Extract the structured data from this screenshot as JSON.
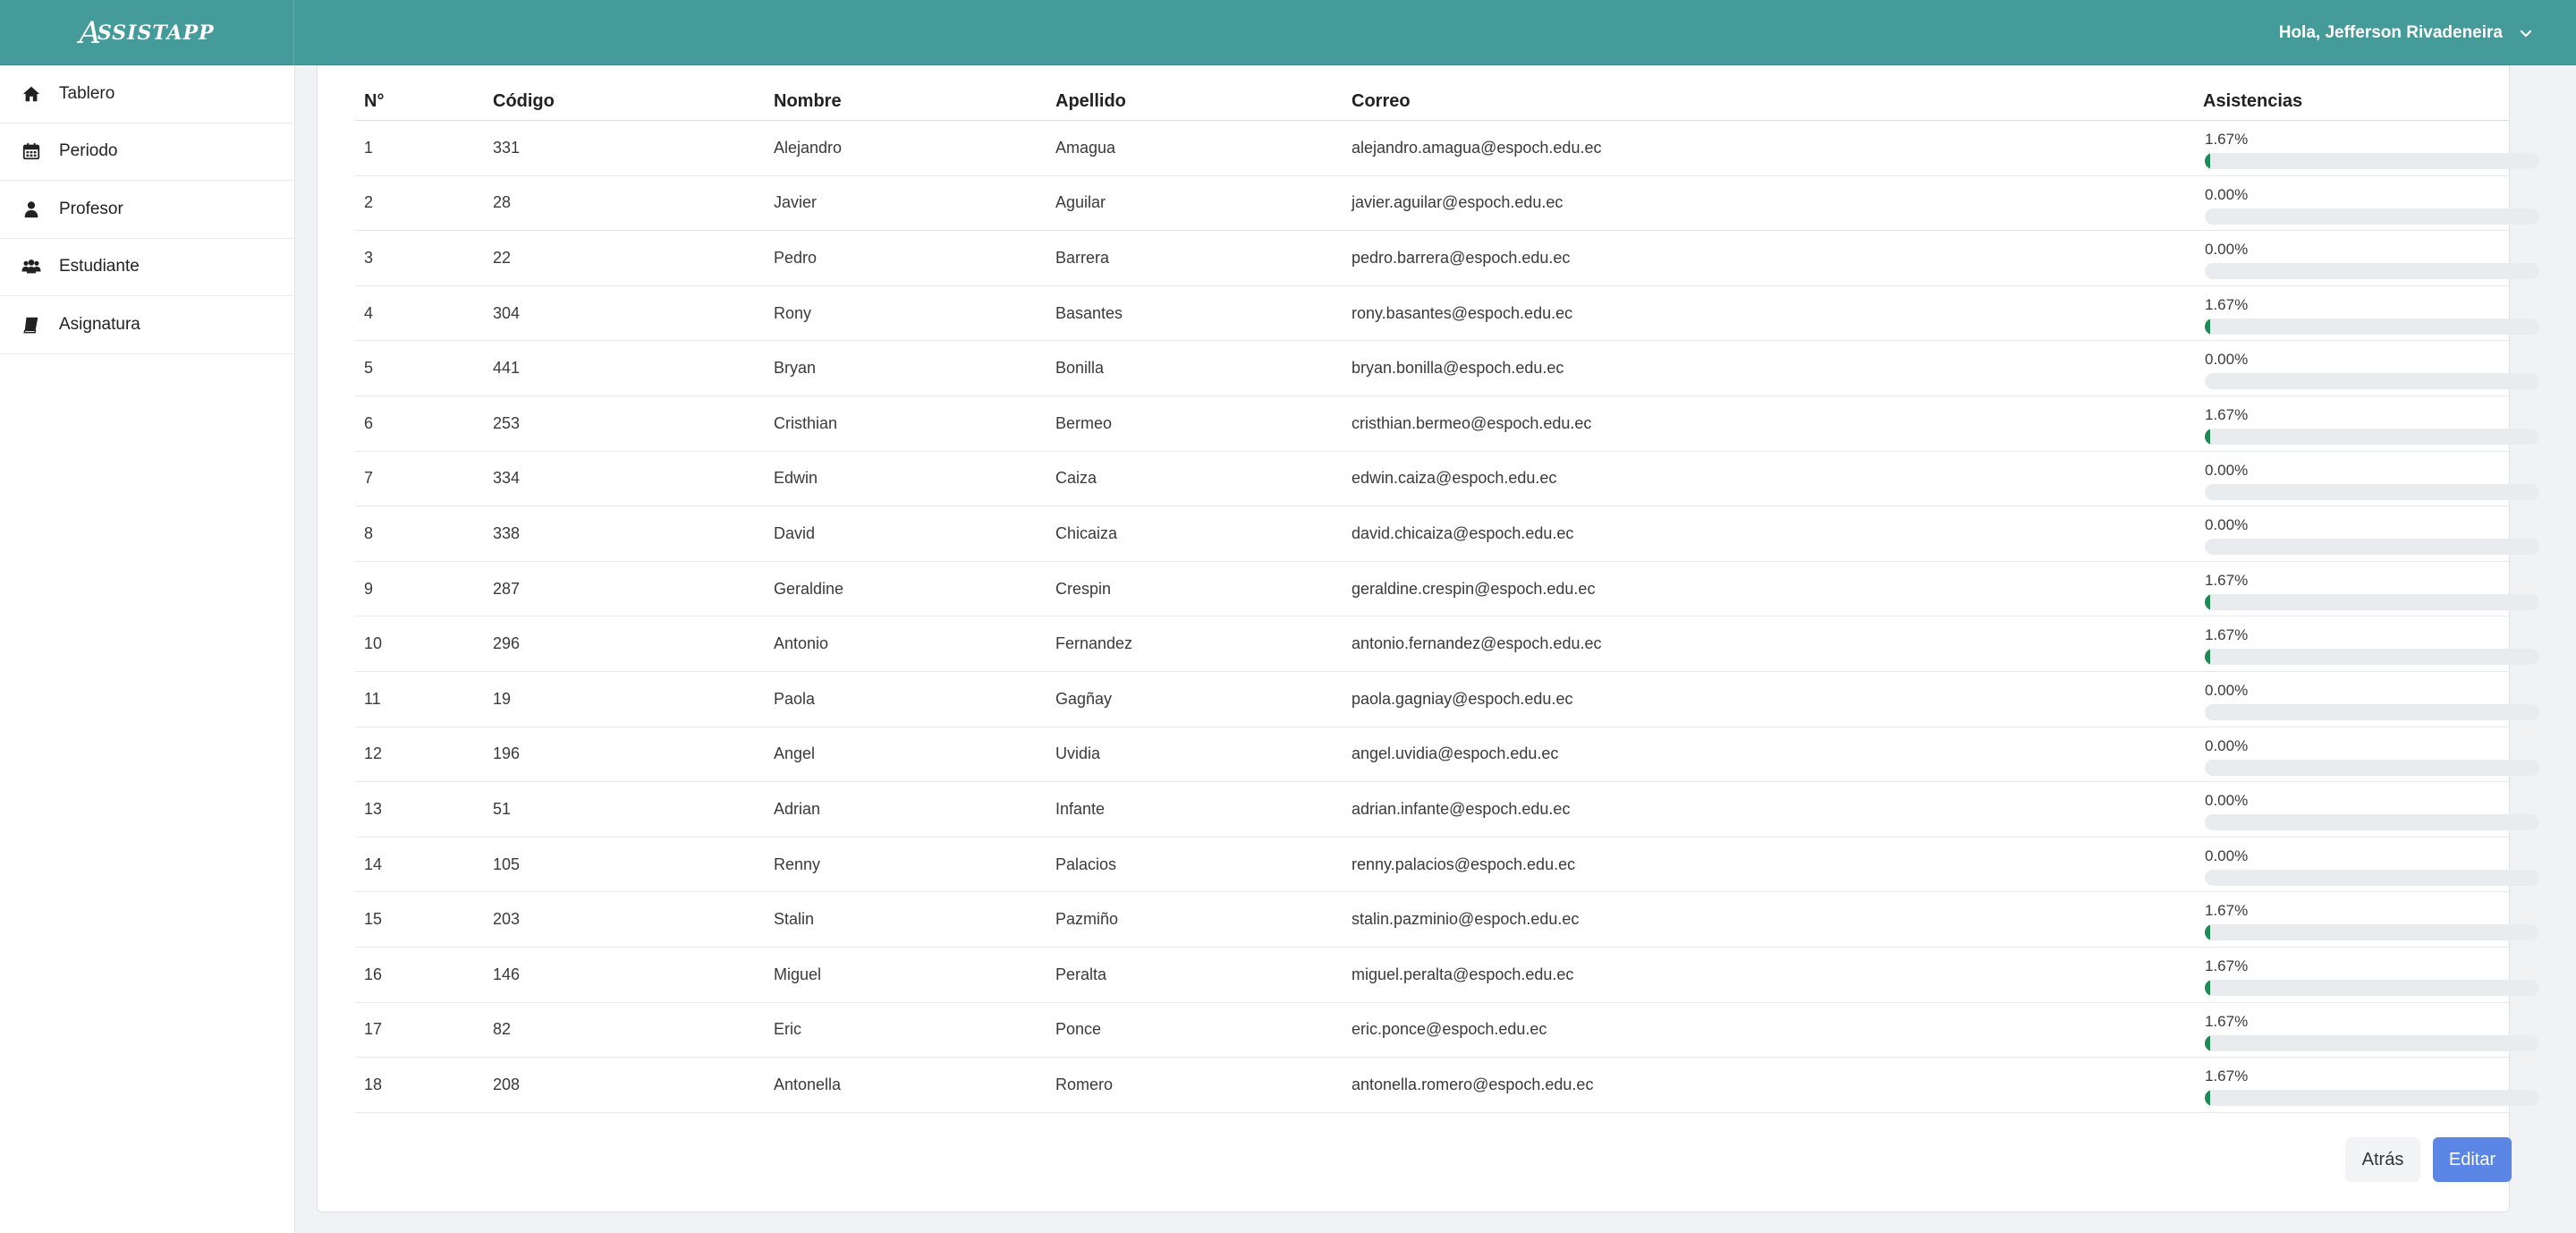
{
  "app": {
    "brand": "SSISTAPP",
    "brand_initial": "A",
    "greeting": "Hola, Jefferson Rivadeneira"
  },
  "colors": {
    "header": "#459a9a",
    "progress_fill": "#1f8a55",
    "progress_track": "#e9ecef",
    "primary_button": "#5b86e5"
  },
  "sidebar": {
    "items": [
      {
        "label": "Tablero",
        "icon": "home-icon"
      },
      {
        "label": "Periodo",
        "icon": "calendar-icon"
      },
      {
        "label": "Profesor",
        "icon": "user-icon"
      },
      {
        "label": "Estudiante",
        "icon": "users-icon"
      },
      {
        "label": "Asignatura",
        "icon": "book-icon"
      }
    ]
  },
  "table": {
    "headers": {
      "no": "N°",
      "codigo": "Código",
      "nombre": "Nombre",
      "apellido": "Apellido",
      "correo": "Correo",
      "asistencias": "Asistencias"
    },
    "rows": [
      {
        "no": "1",
        "codigo": "331",
        "nombre": "Alejandro",
        "apellido": "Amagua",
        "correo": "alejandro.amagua@espoch.edu.ec",
        "asistencia_label": "1.67%",
        "asistencia_pct": 1.67
      },
      {
        "no": "2",
        "codigo": "28",
        "nombre": "Javier",
        "apellido": "Aguilar",
        "correo": "javier.aguilar@espoch.edu.ec",
        "asistencia_label": "0.00%",
        "asistencia_pct": 0
      },
      {
        "no": "3",
        "codigo": "22",
        "nombre": "Pedro",
        "apellido": "Barrera",
        "correo": "pedro.barrera@espoch.edu.ec",
        "asistencia_label": "0.00%",
        "asistencia_pct": 0
      },
      {
        "no": "4",
        "codigo": "304",
        "nombre": "Rony",
        "apellido": "Basantes",
        "correo": "rony.basantes@espoch.edu.ec",
        "asistencia_label": "1.67%",
        "asistencia_pct": 1.67
      },
      {
        "no": "5",
        "codigo": "441",
        "nombre": "Bryan",
        "apellido": "Bonilla",
        "correo": "bryan.bonilla@espoch.edu.ec",
        "asistencia_label": "0.00%",
        "asistencia_pct": 0
      },
      {
        "no": "6",
        "codigo": "253",
        "nombre": "Cristhian",
        "apellido": "Bermeo",
        "correo": "cristhian.bermeo@espoch.edu.ec",
        "asistencia_label": "1.67%",
        "asistencia_pct": 1.67
      },
      {
        "no": "7",
        "codigo": "334",
        "nombre": "Edwin",
        "apellido": "Caiza",
        "correo": "edwin.caiza@espoch.edu.ec",
        "asistencia_label": "0.00%",
        "asistencia_pct": 0
      },
      {
        "no": "8",
        "codigo": "338",
        "nombre": "David",
        "apellido": "Chicaiza",
        "correo": "david.chicaiza@espoch.edu.ec",
        "asistencia_label": "0.00%",
        "asistencia_pct": 0
      },
      {
        "no": "9",
        "codigo": "287",
        "nombre": "Geraldine",
        "apellido": "Crespin",
        "correo": "geraldine.crespin@espoch.edu.ec",
        "asistencia_label": "1.67%",
        "asistencia_pct": 1.67
      },
      {
        "no": "10",
        "codigo": "296",
        "nombre": "Antonio",
        "apellido": "Fernandez",
        "correo": "antonio.fernandez@espoch.edu.ec",
        "asistencia_label": "1.67%",
        "asistencia_pct": 1.67
      },
      {
        "no": "11",
        "codigo": "19",
        "nombre": "Paola",
        "apellido": "Gagñay",
        "correo": "paola.gagniay@espoch.edu.ec",
        "asistencia_label": "0.00%",
        "asistencia_pct": 0
      },
      {
        "no": "12",
        "codigo": "196",
        "nombre": "Angel",
        "apellido": "Uvidia",
        "correo": "angel.uvidia@espoch.edu.ec",
        "asistencia_label": "0.00%",
        "asistencia_pct": 0
      },
      {
        "no": "13",
        "codigo": "51",
        "nombre": "Adrian",
        "apellido": "Infante",
        "correo": "adrian.infante@espoch.edu.ec",
        "asistencia_label": "0.00%",
        "asistencia_pct": 0
      },
      {
        "no": "14",
        "codigo": "105",
        "nombre": "Renny",
        "apellido": "Palacios",
        "correo": "renny.palacios@espoch.edu.ec",
        "asistencia_label": "0.00%",
        "asistencia_pct": 0
      },
      {
        "no": "15",
        "codigo": "203",
        "nombre": "Stalin",
        "apellido": "Pazmiño",
        "correo": "stalin.pazminio@espoch.edu.ec",
        "asistencia_label": "1.67%",
        "asistencia_pct": 1.67
      },
      {
        "no": "16",
        "codigo": "146",
        "nombre": "Miguel",
        "apellido": "Peralta",
        "correo": "miguel.peralta@espoch.edu.ec",
        "asistencia_label": "1.67%",
        "asistencia_pct": 1.67
      },
      {
        "no": "17",
        "codigo": "82",
        "nombre": "Eric",
        "apellido": "Ponce",
        "correo": "eric.ponce@espoch.edu.ec",
        "asistencia_label": "1.67%",
        "asistencia_pct": 1.67
      },
      {
        "no": "18",
        "codigo": "208",
        "nombre": "Antonella",
        "apellido": "Romero",
        "correo": "antonella.romero@espoch.edu.ec",
        "asistencia_label": "1.67%",
        "asistencia_pct": 1.67
      }
    ]
  },
  "actions": {
    "back_label": "Atrás",
    "edit_label": "Editar"
  }
}
